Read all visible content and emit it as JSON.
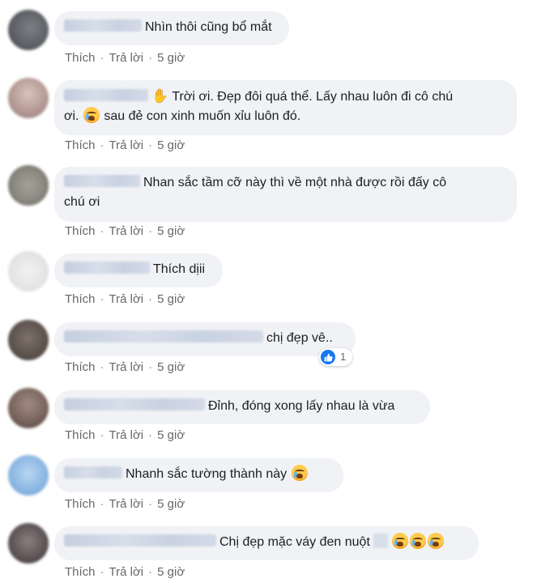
{
  "actions": {
    "like": "Thích",
    "reply": "Trả lời",
    "sep": "·"
  },
  "comments": [
    {
      "text": "Nhìn thôi cũng bổ mắt",
      "time": "5 giờ"
    },
    {
      "text": "Trời ơi. Đẹp đôi quá thể. Lấy nhau luôn đi cô chú",
      "text2": "ơi.",
      "text3": "sau đẻ con xinh muốn xỉu luôn đó.",
      "time": "5 giờ"
    },
    {
      "text": "Nhan sắc tầm cỡ này thì về một nhà được rồi đấy cô",
      "text2": "chú ơi",
      "time": "5 giờ"
    },
    {
      "text": "Thích dịii",
      "time": "5 giờ"
    },
    {
      "text": "chị đẹp vê..",
      "time": "5 giờ",
      "reaction_count": "1"
    },
    {
      "text": "Đỉnh, đóng xong lấy nhau là vừa",
      "time": "5 giờ"
    },
    {
      "text": "Nhanh sắc tường thành này",
      "time": "5 giờ"
    },
    {
      "text": "Chị đẹp mặc váy đen nuột",
      "time": "5 giờ"
    }
  ],
  "colors": {
    "bubble": "#f0f2f5",
    "meta": "#65676b",
    "like_blue": "#1877f2"
  }
}
